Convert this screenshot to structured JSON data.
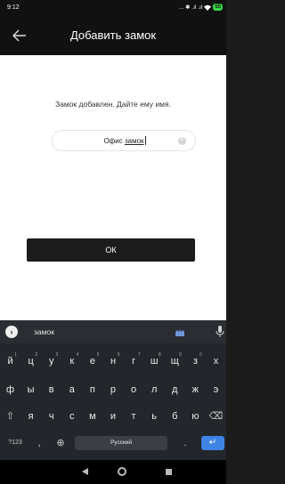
{
  "status": {
    "time": "9:12",
    "icons_text": "... ✱ .ıl .ıl",
    "battery": "55"
  },
  "appbar": {
    "title": "Добавить замок"
  },
  "form": {
    "hint": "Замок добавлен. Дайте ему имя.",
    "name_value_plain": "Офис ",
    "name_value_underlined": "замок",
    "ok_label": "ОК"
  },
  "keyboard": {
    "suggestion": "замок",
    "row1": [
      "й",
      "ц",
      "у",
      "к",
      "е",
      "н",
      "г",
      "ш",
      "щ",
      "з",
      "х"
    ],
    "row1_hints": [
      "1",
      "2",
      "3",
      "4",
      "5",
      "6",
      "7",
      "8",
      "9",
      "0",
      ""
    ],
    "row2": [
      "ф",
      "ы",
      "в",
      "а",
      "п",
      "р",
      "о",
      "л",
      "д",
      "ж",
      "э"
    ],
    "row3": [
      "я",
      "ч",
      "с",
      "м",
      "и",
      "т",
      "ь",
      "б",
      "ю"
    ],
    "mode_key": "?123",
    "comma_key": ",",
    "space_label": "Русский",
    "period_key": "."
  },
  "icons": {
    "back": "arrow-left-icon",
    "clear": "clear-circle-icon",
    "mic": "mic-icon",
    "globe": "globe-icon",
    "shift": "shift-icon",
    "backspace": "backspace-icon",
    "enter": "enter-icon"
  }
}
